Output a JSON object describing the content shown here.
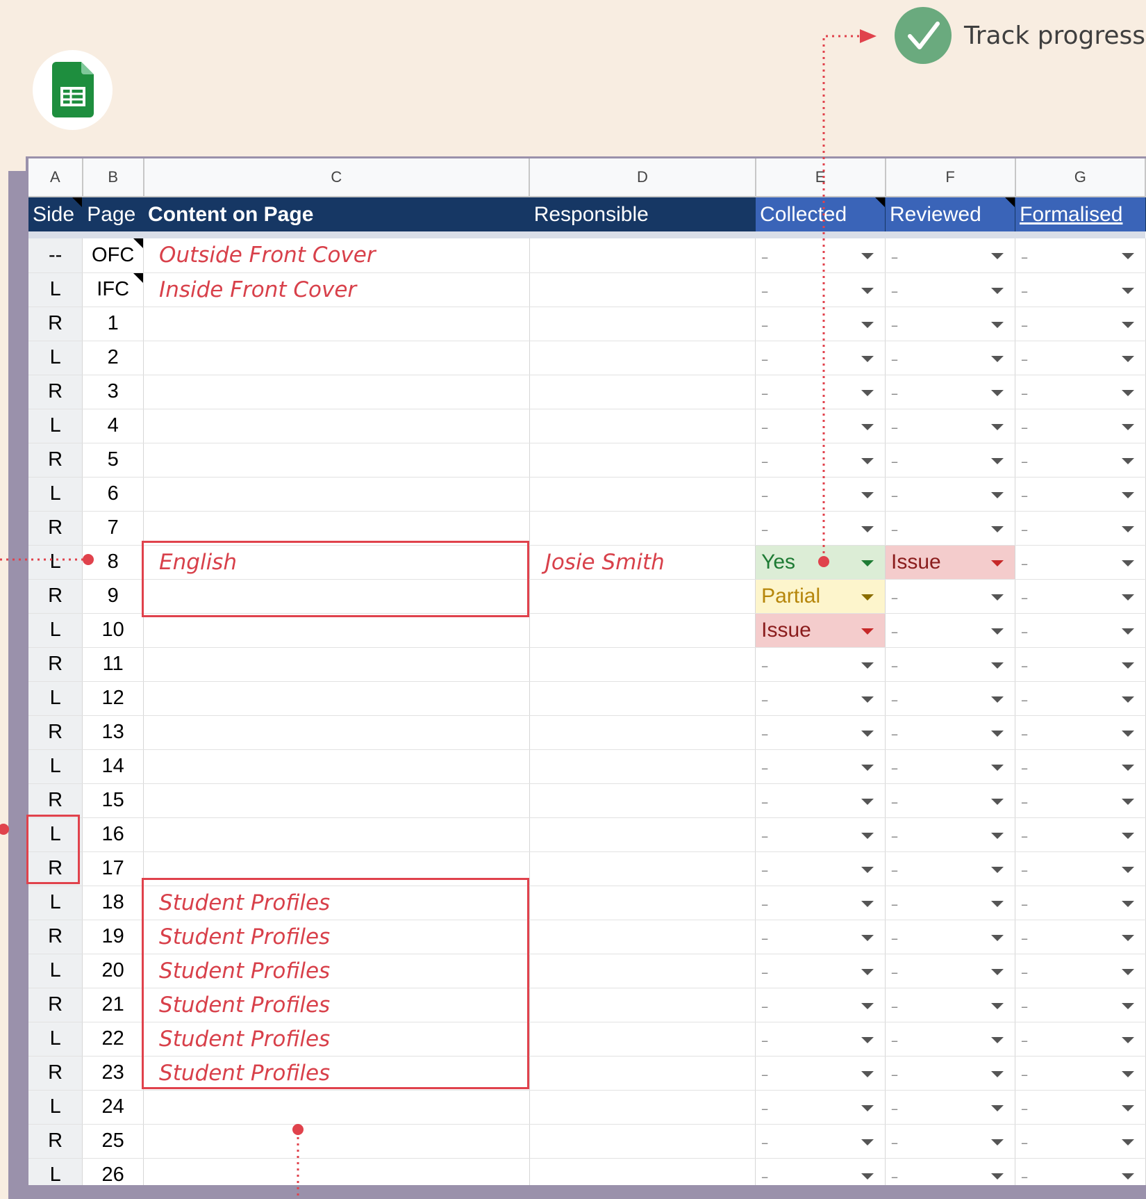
{
  "badge": {
    "text": "Track progress",
    "check_color": "#6aaa7e"
  },
  "logo": {
    "icon": "google-sheets-icon",
    "color": "#1e8e3e"
  },
  "column_letters": [
    "A",
    "B",
    "C",
    "D",
    "E",
    "F",
    "G"
  ],
  "header": {
    "side": "Side",
    "page": "Page",
    "content": "Content on Page",
    "responsible": "Responsible",
    "collected": "Collected",
    "reviewed": "Reviewed",
    "formalised": "Formalised"
  },
  "colors": {
    "header_bg": "#163764",
    "header_status_bg": "#3a64b8",
    "annotation": "#e0424c"
  },
  "rows": [
    {
      "side": "--",
      "page": "OFC",
      "content": "Outside Front Cover",
      "responsible": "",
      "collected": "--",
      "reviewed": "--",
      "formalised": "--"
    },
    {
      "side": "L",
      "page": "IFC",
      "content": "Inside Front Cover",
      "responsible": "",
      "collected": "--",
      "reviewed": "--",
      "formalised": "--"
    },
    {
      "side": "R",
      "page": "1",
      "content": "",
      "responsible": "",
      "collected": "--",
      "reviewed": "--",
      "formalised": "--"
    },
    {
      "side": "L",
      "page": "2",
      "content": "",
      "responsible": "",
      "collected": "--",
      "reviewed": "--",
      "formalised": "--"
    },
    {
      "side": "R",
      "page": "3",
      "content": "",
      "responsible": "",
      "collected": "--",
      "reviewed": "--",
      "formalised": "--"
    },
    {
      "side": "L",
      "page": "4",
      "content": "",
      "responsible": "",
      "collected": "--",
      "reviewed": "--",
      "formalised": "--"
    },
    {
      "side": "R",
      "page": "5",
      "content": "",
      "responsible": "",
      "collected": "--",
      "reviewed": "--",
      "formalised": "--"
    },
    {
      "side": "L",
      "page": "6",
      "content": "",
      "responsible": "",
      "collected": "--",
      "reviewed": "--",
      "formalised": "--"
    },
    {
      "side": "R",
      "page": "7",
      "content": "",
      "responsible": "",
      "collected": "--",
      "reviewed": "--",
      "formalised": "--"
    },
    {
      "side": "L",
      "page": "8",
      "content": "English",
      "responsible": "Josie Smith",
      "collected": "Yes",
      "reviewed": "Issue",
      "formalised": "--"
    },
    {
      "side": "R",
      "page": "9",
      "content": "",
      "responsible": "",
      "collected": "Partial",
      "reviewed": "--",
      "formalised": "--"
    },
    {
      "side": "L",
      "page": "10",
      "content": "",
      "responsible": "",
      "collected": "Issue",
      "reviewed": "--",
      "formalised": "--"
    },
    {
      "side": "R",
      "page": "11",
      "content": "",
      "responsible": "",
      "collected": "--",
      "reviewed": "--",
      "formalised": "--"
    },
    {
      "side": "L",
      "page": "12",
      "content": "",
      "responsible": "",
      "collected": "--",
      "reviewed": "--",
      "formalised": "--"
    },
    {
      "side": "R",
      "page": "13",
      "content": "",
      "responsible": "",
      "collected": "--",
      "reviewed": "--",
      "formalised": "--"
    },
    {
      "side": "L",
      "page": "14",
      "content": "",
      "responsible": "",
      "collected": "--",
      "reviewed": "--",
      "formalised": "--"
    },
    {
      "side": "R",
      "page": "15",
      "content": "",
      "responsible": "",
      "collected": "--",
      "reviewed": "--",
      "formalised": "--"
    },
    {
      "side": "L",
      "page": "16",
      "content": "",
      "responsible": "",
      "collected": "--",
      "reviewed": "--",
      "formalised": "--"
    },
    {
      "side": "R",
      "page": "17",
      "content": "",
      "responsible": "",
      "collected": "--",
      "reviewed": "--",
      "formalised": "--"
    },
    {
      "side": "L",
      "page": "18",
      "content": "Student Profiles",
      "responsible": "",
      "collected": "--",
      "reviewed": "--",
      "formalised": "--"
    },
    {
      "side": "R",
      "page": "19",
      "content": "Student Profiles",
      "responsible": "",
      "collected": "--",
      "reviewed": "--",
      "formalised": "--"
    },
    {
      "side": "L",
      "page": "20",
      "content": "Student Profiles",
      "responsible": "",
      "collected": "--",
      "reviewed": "--",
      "formalised": "--"
    },
    {
      "side": "R",
      "page": "21",
      "content": "Student Profiles",
      "responsible": "",
      "collected": "--",
      "reviewed": "--",
      "formalised": "--"
    },
    {
      "side": "L",
      "page": "22",
      "content": "Student Profiles",
      "responsible": "",
      "collected": "--",
      "reviewed": "--",
      "formalised": "--"
    },
    {
      "side": "R",
      "page": "23",
      "content": "Student Profiles",
      "responsible": "",
      "collected": "--",
      "reviewed": "--",
      "formalised": "--"
    },
    {
      "side": "L",
      "page": "24",
      "content": "",
      "responsible": "",
      "collected": "--",
      "reviewed": "--",
      "formalised": "--"
    },
    {
      "side": "R",
      "page": "25",
      "content": "",
      "responsible": "",
      "collected": "--",
      "reviewed": "--",
      "formalised": "--"
    },
    {
      "side": "L",
      "page": "26",
      "content": "",
      "responsible": "",
      "collected": "--",
      "reviewed": "--",
      "formalised": "--"
    }
  ]
}
